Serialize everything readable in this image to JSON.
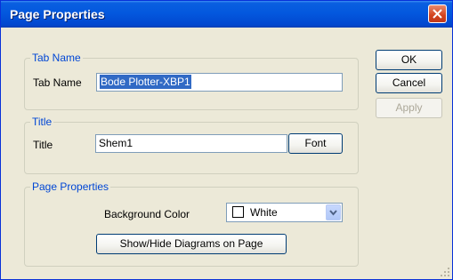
{
  "window": {
    "title": "Page Properties"
  },
  "tab_name_group": {
    "legend": "Tab Name",
    "label": "Tab Name",
    "value": "Bode Plotter-XBP1"
  },
  "title_group": {
    "legend": "Title",
    "label": "Title",
    "value": "Shem1",
    "font_button": "Font"
  },
  "page_props_group": {
    "legend": "Page Properties",
    "bg_color_label": "Background Color",
    "bg_color_value": "White",
    "show_hide_button": "Show/Hide Diagrams on Page"
  },
  "buttons": {
    "ok": "OK",
    "cancel": "Cancel",
    "apply": "Apply"
  },
  "colors": {
    "titlebar": "#0358de",
    "dialog_bg": "#ece9d8",
    "legend_text": "#0046d5",
    "selection": "#316ac5"
  },
  "icons": {
    "close": "close-icon",
    "dropdown": "chevron-down-icon",
    "grip": "resize-grip-icon"
  }
}
